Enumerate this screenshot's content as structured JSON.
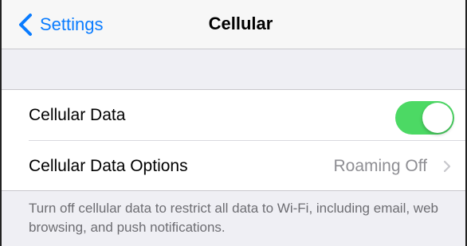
{
  "navbar": {
    "back_label": "Settings",
    "title": "Cellular"
  },
  "cellular_group": {
    "rows": [
      {
        "label": "Cellular Data",
        "toggle_on": true
      },
      {
        "label": "Cellular Data Options",
        "value": "Roaming Off"
      }
    ]
  },
  "footer": {
    "text": "Turn off cellular data to restrict all data to Wi-Fi, including email, web browsing, and push notifications."
  },
  "colors": {
    "accent": "#0a7cff",
    "toggle_on": "#4cd964",
    "background": "#efeff4",
    "secondary_text": "#8e8e93",
    "footer_text": "#6d6d72"
  },
  "icons": {
    "back": "chevron-left-icon",
    "disclosure": "chevron-right-icon"
  }
}
